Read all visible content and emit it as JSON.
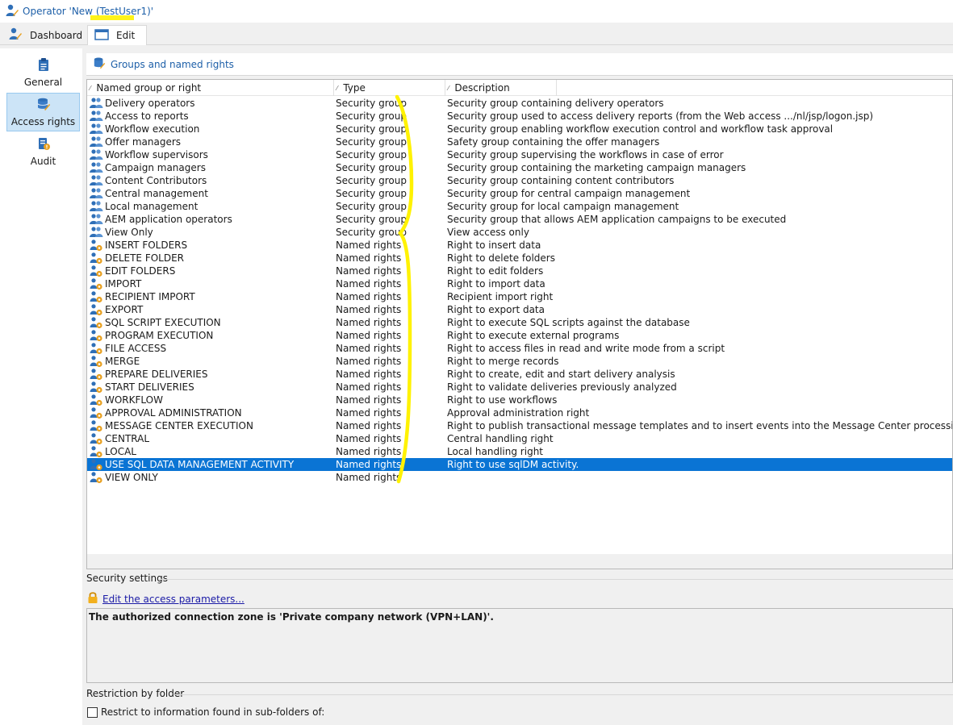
{
  "window": {
    "title": "Operator 'New (TestUser1)'"
  },
  "tabs": [
    {
      "label": "Dashboard"
    },
    {
      "label": "Edit"
    }
  ],
  "nav": {
    "general": "General",
    "access_rights": "Access rights",
    "audit": "Audit"
  },
  "section": {
    "title": "Groups and named rights"
  },
  "grid": {
    "columns": [
      "Named group or right",
      "Type",
      "Description"
    ],
    "rows": [
      {
        "name": "Delivery operators",
        "type": "Security group",
        "desc": "Security group containing delivery operators",
        "kind": "group"
      },
      {
        "name": "Access to reports",
        "type": "Security group",
        "desc": "Security group used to access delivery reports (from the Web access .../nl/jsp/logon.jsp)",
        "kind": "group"
      },
      {
        "name": "Workflow execution",
        "type": "Security group",
        "desc": "Security group enabling workflow execution control and workflow task approval",
        "kind": "group"
      },
      {
        "name": "Offer managers",
        "type": "Security group",
        "desc": "Safety group containing the offer managers",
        "kind": "group"
      },
      {
        "name": "Workflow supervisors",
        "type": "Security group",
        "desc": "Security group supervising the workflows in case of error",
        "kind": "group"
      },
      {
        "name": "Campaign managers",
        "type": "Security group",
        "desc": "Security group containing the marketing campaign managers",
        "kind": "group"
      },
      {
        "name": "Content Contributors",
        "type": "Security group",
        "desc": "Security group containing content contributors",
        "kind": "group"
      },
      {
        "name": "Central management",
        "type": "Security group",
        "desc": "Security group for central campaign management",
        "kind": "group"
      },
      {
        "name": "Local management",
        "type": "Security group",
        "desc": "Security group for local campaign management",
        "kind": "group"
      },
      {
        "name": "AEM application operators",
        "type": "Security group",
        "desc": "Security group that allows AEM application campaigns to be executed",
        "kind": "group"
      },
      {
        "name": "View Only",
        "type": "Security group",
        "desc": "View access only",
        "kind": "group"
      },
      {
        "name": "INSERT FOLDERS",
        "type": "Named rights",
        "desc": "Right to insert data",
        "kind": "right"
      },
      {
        "name": "DELETE FOLDER",
        "type": "Named rights",
        "desc": "Right to delete folders",
        "kind": "right"
      },
      {
        "name": "EDIT FOLDERS",
        "type": "Named rights",
        "desc": "Right to edit folders",
        "kind": "right"
      },
      {
        "name": "IMPORT",
        "type": "Named rights",
        "desc": "Right to import data",
        "kind": "right"
      },
      {
        "name": "RECIPIENT IMPORT",
        "type": "Named rights",
        "desc": "Recipient import right",
        "kind": "right"
      },
      {
        "name": "EXPORT",
        "type": "Named rights",
        "desc": "Right to export data",
        "kind": "right"
      },
      {
        "name": "SQL SCRIPT EXECUTION",
        "type": "Named rights",
        "desc": "Right to execute SQL scripts against the database",
        "kind": "right"
      },
      {
        "name": "PROGRAM EXECUTION",
        "type": "Named rights",
        "desc": "Right to execute external programs",
        "kind": "right"
      },
      {
        "name": "FILE ACCESS",
        "type": "Named rights",
        "desc": "Right to access files in read and write mode from a script",
        "kind": "right"
      },
      {
        "name": "MERGE",
        "type": "Named rights",
        "desc": "Right to merge records",
        "kind": "right"
      },
      {
        "name": "PREPARE DELIVERIES",
        "type": "Named rights",
        "desc": "Right to create, edit and start delivery analysis",
        "kind": "right"
      },
      {
        "name": "START DELIVERIES",
        "type": "Named rights",
        "desc": "Right to validate deliveries previously analyzed",
        "kind": "right"
      },
      {
        "name": "WORKFLOW",
        "type": "Named rights",
        "desc": "Right to use workflows",
        "kind": "right"
      },
      {
        "name": "APPROVAL ADMINISTRATION",
        "type": "Named rights",
        "desc": "Approval administration right",
        "kind": "right"
      },
      {
        "name": "MESSAGE CENTER EXECUTION",
        "type": "Named rights",
        "desc": "Right to publish transactional message templates and to insert events into the Message Center processing queue.",
        "kind": "right"
      },
      {
        "name": "CENTRAL",
        "type": "Named rights",
        "desc": "Central handling right",
        "kind": "right"
      },
      {
        "name": "LOCAL",
        "type": "Named rights",
        "desc": "Local handling right",
        "kind": "right"
      },
      {
        "name": "USE SQL DATA MANAGEMENT ACTIVITY",
        "type": "Named rights",
        "desc": "Right to use sqlDM activity.",
        "kind": "right",
        "selected": true
      },
      {
        "name": "VIEW ONLY",
        "type": "Named rights",
        "desc": "",
        "kind": "right"
      }
    ]
  },
  "security": {
    "label": "Security settings",
    "link": "Edit the access parameters...",
    "zone_text": "The authorized connection zone is 'Private company network (VPN+LAN)'."
  },
  "restriction": {
    "label": "Restriction by folder",
    "checkbox_label": "Restrict to information found in sub-folders of:",
    "checked": false
  },
  "colors": {
    "accent": "#1d5fa8",
    "selection": "#0a74d4",
    "highlight": "#fff200"
  }
}
